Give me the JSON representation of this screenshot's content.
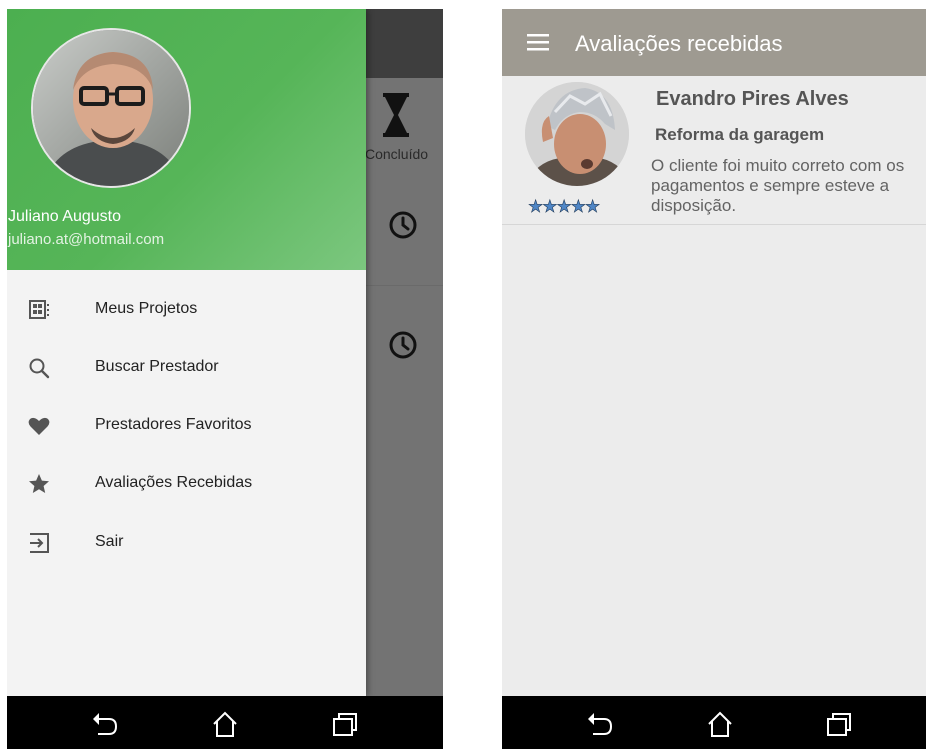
{
  "left_screen": {
    "background_app": {
      "status_label": "Concluído",
      "icons": [
        "hourglass-icon",
        "clock-icon",
        "clock-icon"
      ]
    },
    "drawer": {
      "user": {
        "name": "Juliano Augusto",
        "email": "juliano.at@hotmail.com"
      },
      "items": [
        {
          "label": "Meus Projetos",
          "icon": "projects-icon"
        },
        {
          "label": "Buscar Prestador",
          "icon": "search-icon"
        },
        {
          "label": "Prestadores Favoritos",
          "icon": "heart-icon"
        },
        {
          "label": "Avaliações Recebidas",
          "icon": "star-icon"
        },
        {
          "label": "Sair",
          "icon": "exit-icon"
        }
      ],
      "header_color": "#4caf50"
    }
  },
  "right_screen": {
    "appbar": {
      "title": "Avaliações recebidas",
      "color": "#9e9a91"
    },
    "reviews": [
      {
        "reviewer": "Evandro Pires Alves",
        "project": "Reforma da garagem",
        "comment": "O cliente foi muito correto com os pagamentos e sempre esteve a disposição.",
        "stars": "★★★★★",
        "rating": 5
      }
    ],
    "star_color": "#4f86c6"
  },
  "navbar": {
    "buttons": [
      "back-icon",
      "home-icon",
      "recents-icon"
    ]
  }
}
